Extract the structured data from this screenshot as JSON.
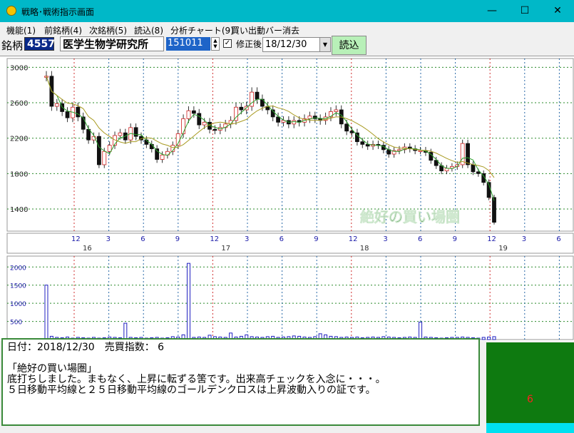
{
  "window": {
    "title": "戦略･戦術指示画面",
    "minimize": "—",
    "maximize": "☐",
    "close": "✕"
  },
  "menu": [
    "機能(1)",
    "前銘柄(4)",
    "次銘柄(5)",
    "読込(8)",
    "分析チャート(9)",
    "買い出動バー消去"
  ],
  "toolbar": {
    "label": "銘柄",
    "code": "4557",
    "name": "医学生物学研究所",
    "number": "151011",
    "checkbox_checked": true,
    "checkbox_label": "修正後",
    "date": "18/12/30",
    "load_button": "読込"
  },
  "chart_data": {
    "type": "candlestick",
    "price_axis": {
      "ticks": [
        3000,
        2600,
        2200,
        1800,
        1400
      ],
      "range": [
        1150,
        3100
      ]
    },
    "volume_axis": {
      "ticks": [
        2000,
        1500,
        1000,
        500
      ],
      "range": [
        0,
        2300
      ]
    },
    "month_ticks": [
      "12",
      "3",
      "6",
      "9",
      "12",
      "3",
      "6",
      "9",
      "12",
      "3",
      "6",
      "9",
      "12",
      "3",
      "6"
    ],
    "year_labels": [
      "16",
      "17",
      "18",
      "19"
    ],
    "price_series": [
      2900,
      2560,
      2590,
      2500,
      2430,
      2550,
      2440,
      2300,
      2180,
      2220,
      1900,
      2050,
      2120,
      2230,
      2260,
      2180,
      2320,
      2220,
      2180,
      2130,
      2080,
      1960,
      2010,
      2050,
      2120,
      2250,
      2420,
      2510,
      2480,
      2350,
      2380,
      2300,
      2290,
      2320,
      2360,
      2400,
      2550,
      2520,
      2560,
      2720,
      2640,
      2560,
      2520,
      2440,
      2380,
      2400,
      2360,
      2400,
      2380,
      2420,
      2450,
      2420,
      2400,
      2440,
      2500,
      2520,
      2360,
      2280,
      2260,
      2160,
      2130,
      2110,
      2130,
      2120,
      2070,
      2020,
      2060,
      2070,
      2100,
      2080,
      2060,
      2060,
      2040,
      1950,
      1890,
      1830,
      1860,
      1880,
      1900,
      2140,
      1900,
      1820,
      1800,
      1700,
      1530,
      1250
    ],
    "volume_series": [
      1500,
      90,
      60,
      50,
      70,
      40,
      60,
      50,
      40,
      60,
      40,
      50,
      70,
      60,
      50,
      450,
      60,
      50,
      60,
      40,
      50,
      60,
      40,
      50,
      80,
      70,
      130,
      2100,
      60,
      70,
      60,
      120,
      80,
      70,
      60,
      180,
      70,
      90,
      130,
      80,
      70,
      60,
      80,
      90,
      60,
      70,
      80,
      100,
      90,
      70,
      60,
      80,
      160,
      130,
      90,
      80,
      60,
      70,
      60,
      70,
      50,
      60,
      70,
      60,
      80,
      70,
      60,
      50,
      60,
      70,
      60,
      480,
      70,
      60,
      50,
      40,
      50,
      60,
      60,
      70,
      60,
      50,
      40,
      60,
      70,
      80
    ],
    "annotation": "絶好の買い場圏"
  },
  "commentary": {
    "date_line": "日付：2018/12/30　売買指数： 6",
    "blank": "",
    "title": "「絶好の買い場圏」",
    "line1": "底打ちしました。まもなく、上昇に転ずる筈です。出来高チェックを入念に・・・。",
    "line2": "５日移動平均線と２５日移動平均線のゴールデンクロスは上昇波動入りの証です。"
  },
  "signal": {
    "value": "6",
    "colors": {
      "bg": "#0e7a10",
      "value": "#ff2020",
      "bar": "#00e0f0"
    }
  }
}
